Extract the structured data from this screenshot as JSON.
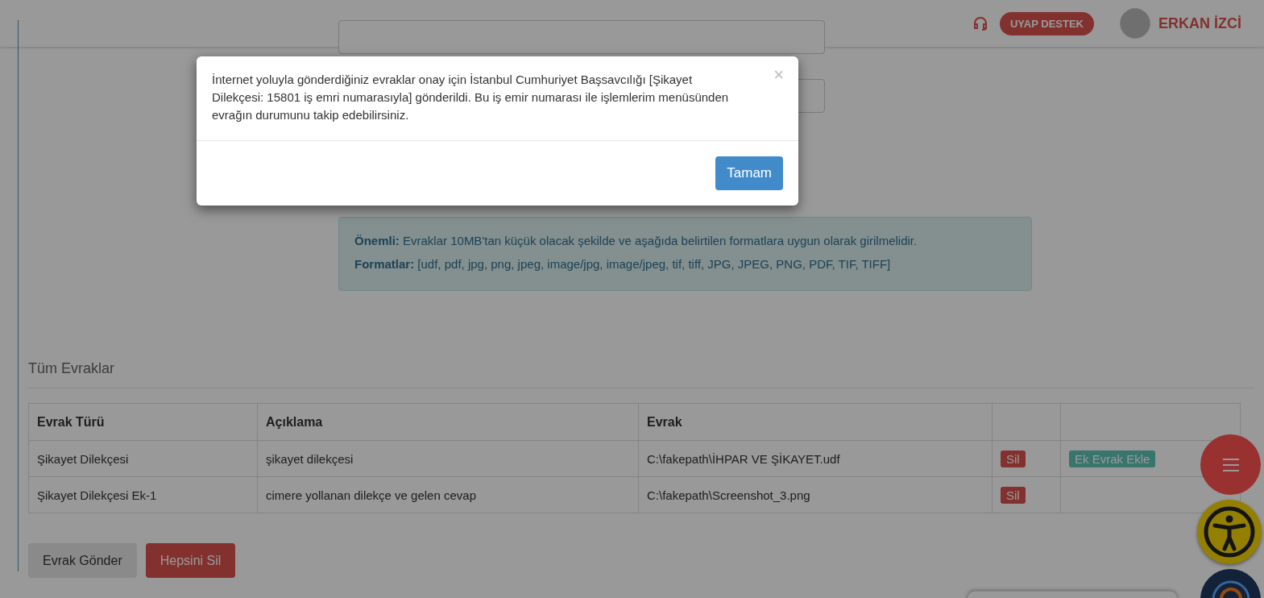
{
  "header": {
    "support_button": "UYAP DESTEK",
    "user_name": "ERKAN İZCİ"
  },
  "notice": {
    "lines": [
      "**Önemli:** Evraklar 10MB'tan küçük olacak şekilde ve aşağıda belirtilen formatlara uygun olarak girilmelidir.",
      "**Formatlar:** [udf, pdf, jpg, png, jpeg, image/jpg, image/jpeg, tif, tiff, JPG, JPEG, PNG, PDF, TIF, TIFF]"
    ]
  },
  "documents": {
    "title": "Tüm Evraklar",
    "columns": [
      "Evrak Türü",
      "Açıklama",
      "Evrak"
    ],
    "rows": [
      {
        "type": "Şikayet Dilekçesi",
        "description": "şikayet dilekçesi",
        "file": "C:\\fakepath\\İHPAR VE ŞİKAYET.udf",
        "delete_button": "Sil",
        "attach_button": "Ek Evrak Ekle"
      },
      {
        "type": "Şikayet Dilekçesi Ek-1",
        "description": "cimere yollanan dilekçe ve gelen cevap",
        "file": "C:\\fakepath\\Screenshot_3.png",
        "delete_button": "Sil"
      }
    ]
  },
  "actions": [
    {
      "kind": "default",
      "label": "Evrak Gönder"
    },
    {
      "kind": "danger",
      "label": "Hepsini Sil"
    }
  ],
  "modal": {
    "message": "İnternet yoluyla gönderdiğiniz evraklar onay için İstanbul Cumhuriyet Başsavcılığı [Şikayet Dilekçesi: 15801 iş emri numarasıyla] gönderildi. Bu iş emir numarası ile işlemlerim menüsünden evrağın durumunu takip edebilirsiniz.",
    "close": "×",
    "confirm": "Tamam"
  }
}
